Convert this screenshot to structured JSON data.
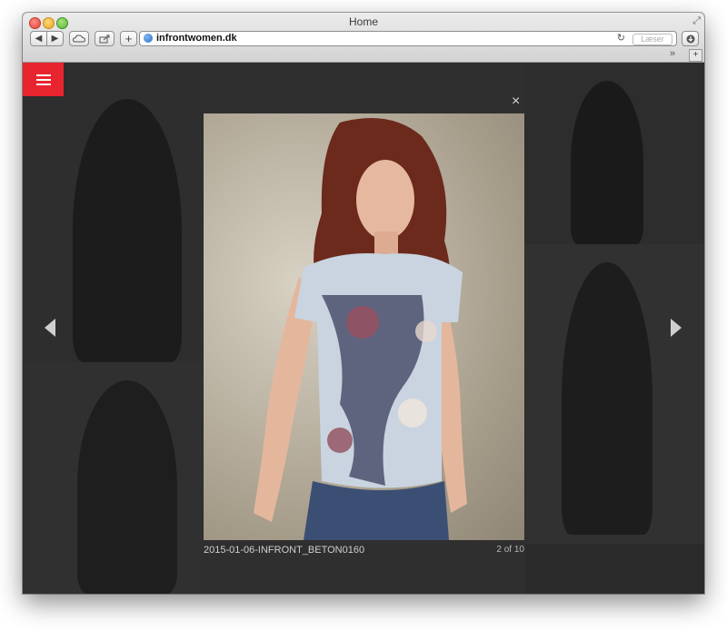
{
  "window": {
    "title": "Home"
  },
  "toolbar": {
    "back_label": "◀",
    "forward_label": "▶",
    "add_label": "+",
    "url": "infrontwomen.dk",
    "reader_label": "Læser",
    "overflow_label": "»",
    "newtab_label": "+"
  },
  "lightbox": {
    "close_label": "×",
    "caption": "2015-01-06-INFRONT_BETON0160",
    "counter": "2 of 10"
  },
  "colors": {
    "menu_accent": "#e8242f",
    "overlay_bg": "#2b2b2b"
  },
  "icons": [
    "globe-icon",
    "reload-icon",
    "cloud-icon",
    "share-icon",
    "download-icon",
    "hamburger-menu-icon",
    "close-icon",
    "chevron-left-icon",
    "chevron-right-icon"
  ]
}
